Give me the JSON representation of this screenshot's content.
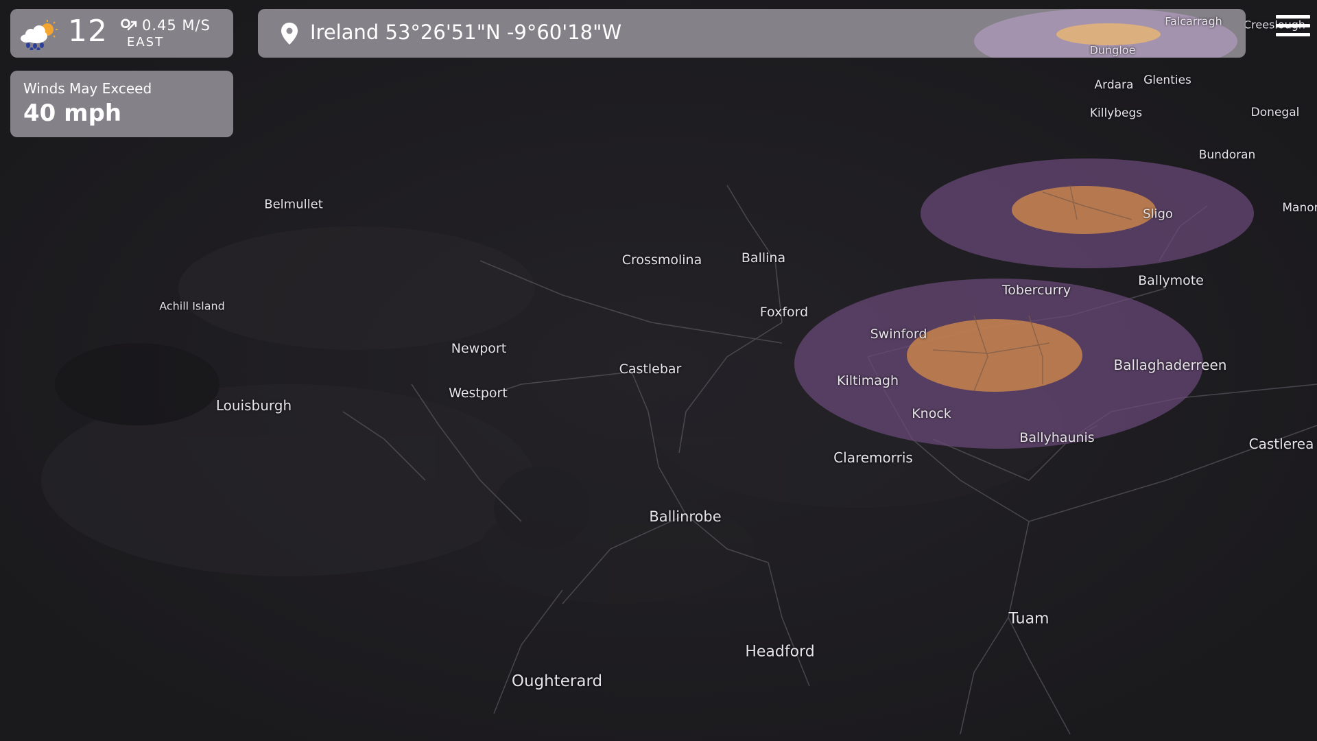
{
  "weather": {
    "icon": "cloud-rain-sun-icon",
    "temperature": "12 °",
    "wind_speed": "0.45 M/S",
    "wind_direction": "EAST"
  },
  "alert": {
    "title": "Winds May Exceed",
    "value": "40 mph"
  },
  "location": {
    "icon": "map-pin-icon",
    "text": "Ireland 53°26'51\"N -9°60'18\"W"
  },
  "menu": {
    "icon": "hamburger-menu-icon"
  },
  "colors": {
    "map_background": "#1b1a1d",
    "panel": "#8e8a92",
    "zone_outer": "#6a4a78",
    "zone_inner": "#c8844c"
  },
  "places": {
    "falcarragh": "Falcarragh",
    "creeslough": "Creeslough",
    "dungloe": "Dungloe",
    "ardara": "Ardara",
    "glenties": "Glenties",
    "killybegs": "Killybegs",
    "donegal": "Donegal",
    "bundoran": "Bundoran",
    "manor": "Manor",
    "belmullet": "Belmullet",
    "sligo": "Sligo",
    "crossmolina": "Crossmolina",
    "ballina": "Ballina",
    "ballymote": "Ballymote",
    "tobercurry": "Tobercurry",
    "achill": "Achill Island",
    "foxford": "Foxford",
    "swinford": "Swinford",
    "newport": "Newport",
    "castlebar": "Castlebar",
    "ballaghaderreen": "Ballaghaderreen",
    "kiltimagh": "Kiltimagh",
    "westport": "Westport",
    "louisburgh": "Louisburgh",
    "knock": "Knock",
    "ballyhaunis": "Ballyhaunis",
    "castlerea": "Castlerea",
    "claremorris": "Claremorris",
    "ballinrobe": "Ballinrobe",
    "tuam": "Tuam",
    "headford": "Headford",
    "oughterard": "Oughterard"
  }
}
